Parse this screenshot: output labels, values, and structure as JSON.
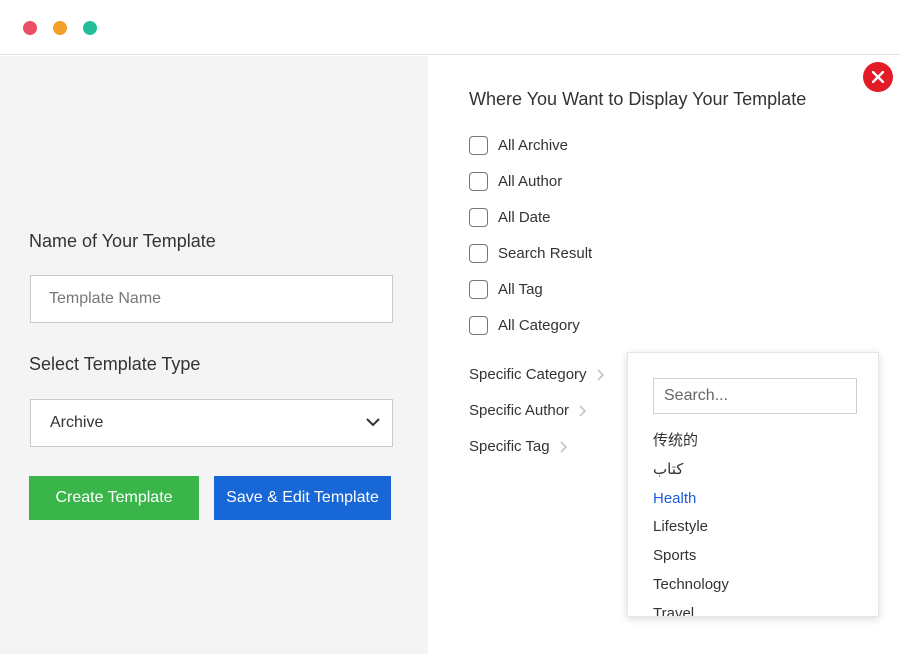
{
  "window": {
    "controls": [
      "close",
      "minimize",
      "maximize"
    ],
    "colors": {
      "close": "#ec4f64",
      "minimize": "#f2a22a",
      "maximize": "#22bf9a"
    }
  },
  "left_panel": {
    "name_label": "Name of Your Template",
    "name_placeholder": "Template Name",
    "name_value": "",
    "type_label": "Select Template Type",
    "type_selected": "Archive",
    "create_button": "Create Template",
    "save_button": "Save & Edit Template",
    "colors": {
      "create": "#39b54a",
      "save": "#1867d6"
    }
  },
  "right_panel": {
    "title": "Where You Want to Display Your Template",
    "checkboxes": [
      {
        "label": "All Archive",
        "checked": false
      },
      {
        "label": "All Author",
        "checked": false
      },
      {
        "label": "All Date",
        "checked": false
      },
      {
        "label": "Search Result",
        "checked": false
      },
      {
        "label": "All Tag",
        "checked": false
      },
      {
        "label": "All Category",
        "checked": false
      }
    ],
    "specific": [
      {
        "label": "Specific Category"
      },
      {
        "label": "Specific Author"
      },
      {
        "label": "Specific Tag"
      }
    ],
    "close_icon": "close-icon",
    "close_color": "#e21b27"
  },
  "dropdown": {
    "search_placeholder": "Search...",
    "items": [
      "传统的",
      "كتاب",
      "Health",
      "Lifestyle",
      "Sports",
      "Technology",
      "Travel"
    ],
    "active_item": "Health",
    "active_color": "#1c5ddb"
  }
}
